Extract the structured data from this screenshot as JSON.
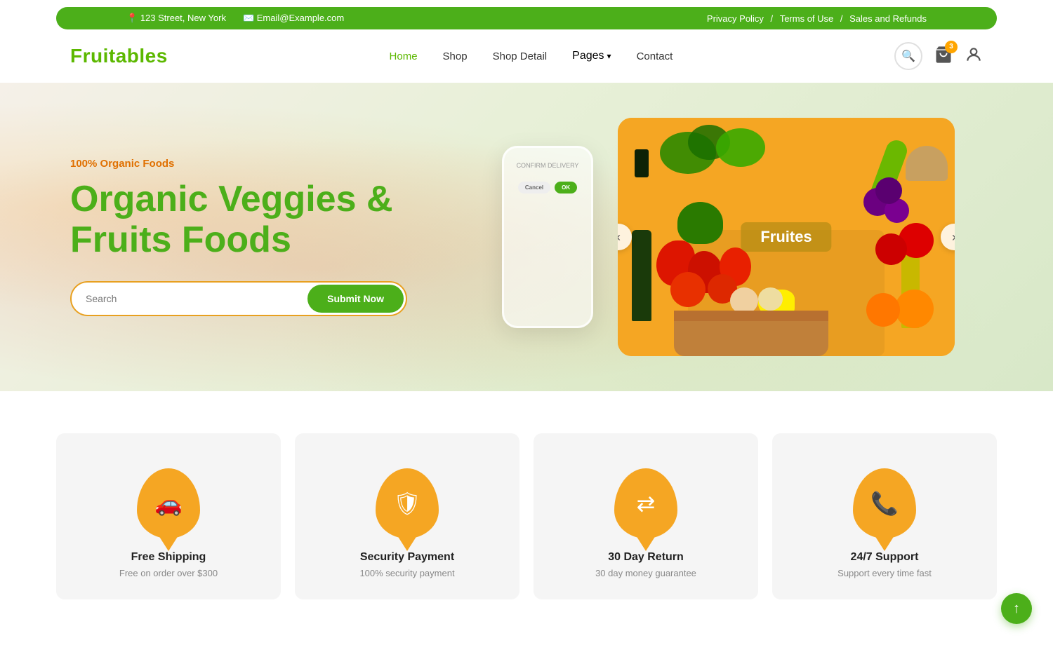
{
  "topbar": {
    "address": "123 Street, New York",
    "email": "Email@Example.com",
    "links": [
      "Privacy Policy",
      "Terms of Use",
      "Sales and Refunds"
    ]
  },
  "header": {
    "logo": "Fruitables",
    "nav": [
      {
        "label": "Home",
        "active": true
      },
      {
        "label": "Shop",
        "active": false
      },
      {
        "label": "Shop Detail",
        "active": false
      },
      {
        "label": "Pages",
        "active": false,
        "hasDropdown": true
      },
      {
        "label": "Contact",
        "active": false
      }
    ],
    "cart_count": "3"
  },
  "hero": {
    "subtitle": "100% Organic Foods",
    "title": "Organic Veggies & Fruits Foods",
    "search_placeholder": "Search",
    "search_button": "Submit Now"
  },
  "phone_mockup": {
    "screen_text": "CONFIRM DELIVERY"
  },
  "carousel": {
    "label": "Fruites",
    "prev_label": "‹",
    "next_label": "›"
  },
  "features": [
    {
      "icon": "🚗",
      "title": "Free Shipping",
      "description": "Free on order over $300"
    },
    {
      "icon": "🛡",
      "title": "Security Payment",
      "description": "100% security payment"
    },
    {
      "icon": "↔",
      "title": "30 Day Return",
      "description": "30 day money guarantee"
    },
    {
      "icon": "📞",
      "title": "24/7 Support",
      "description": "Support every time fast"
    }
  ],
  "scroll_top": "↑"
}
